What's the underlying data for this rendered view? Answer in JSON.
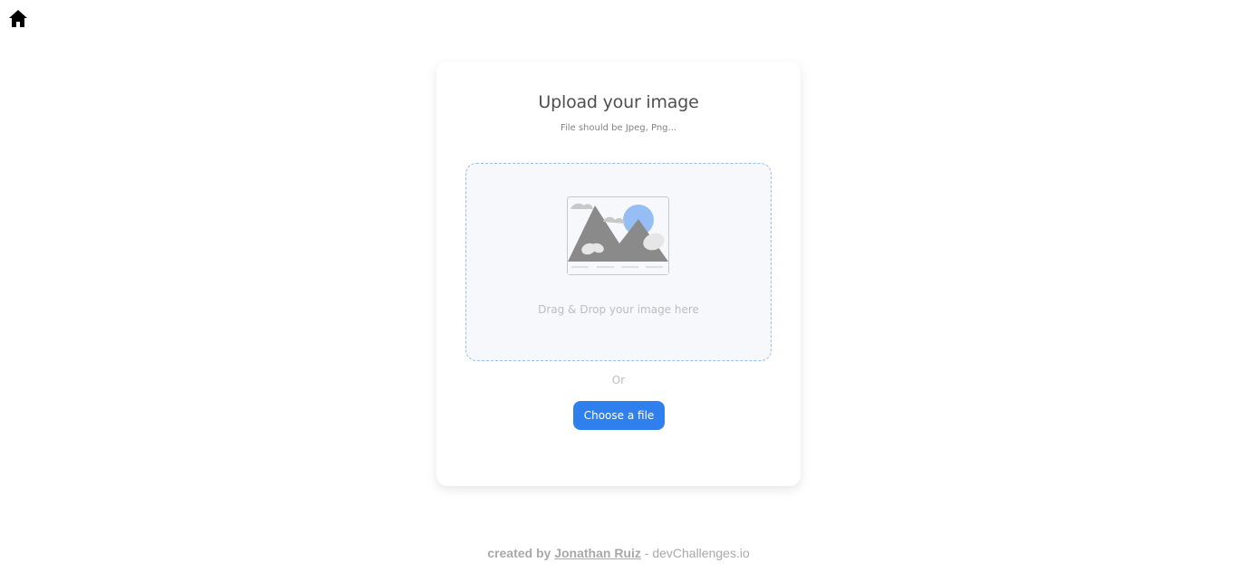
{
  "nav": {
    "home_icon": "home-icon"
  },
  "card": {
    "title": "Upload your image",
    "subtitle": "File should be Jpeg, Png...",
    "dropzone": {
      "text": "Drag & Drop your image here",
      "icon": "image-illustration-icon"
    },
    "or_text": "Or",
    "choose_button_label": "Choose a file"
  },
  "footer": {
    "prefix": "created by",
    "author": "Jonathan Ruiz",
    "suffix": "- devChallenges.io"
  },
  "colors": {
    "accent": "#2f80ed",
    "dropzone_border": "#97bef4",
    "dropzone_bg": "#f6f8fb"
  }
}
